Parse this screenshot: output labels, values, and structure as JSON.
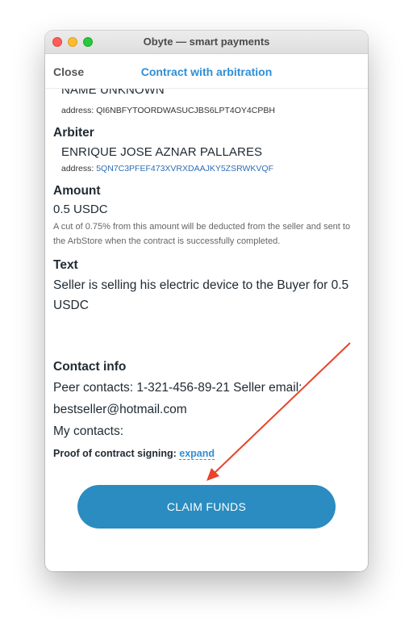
{
  "window": {
    "title": "Obyte — smart payments"
  },
  "header": {
    "close_label": "Close",
    "title": "Contract with arbitration"
  },
  "peer": {
    "name": "NAME UNKNOWN",
    "address_prefix": "address: ",
    "address": "QI6NBFYTOORDWASUCJBS6LPT4OY4CPBH"
  },
  "arbiter": {
    "label": "Arbiter",
    "name": "ENRIQUE JOSE AZNAR PALLARES",
    "address_prefix": "address: ",
    "address": "5QN7C3PFEF473XVRXDAAJKY5ZSRWKVQF"
  },
  "amount": {
    "label": "Amount",
    "value": "0.5 USDC",
    "note": "A cut of 0.75% from this amount will be deducted from the seller and sent to the ArbStore when the contract is successfully completed."
  },
  "text": {
    "label": "Text",
    "value": "Seller is selling his electric device to the Buyer for 0.5 USDC"
  },
  "contact": {
    "label": "Contact info",
    "peer_line1": "Peer contacts: 1-321-456-89-21 Seller email:",
    "peer_line2": "bestseller@hotmail.com",
    "my_contacts": "My contacts:"
  },
  "proof": {
    "label": "Proof of contract signing:",
    "expand": "expand"
  },
  "claim_button": "CLAIM FUNDS",
  "colors": {
    "accent": "#2e8fd6",
    "button": "#2a8cc0",
    "arrow": "#e8432b"
  }
}
